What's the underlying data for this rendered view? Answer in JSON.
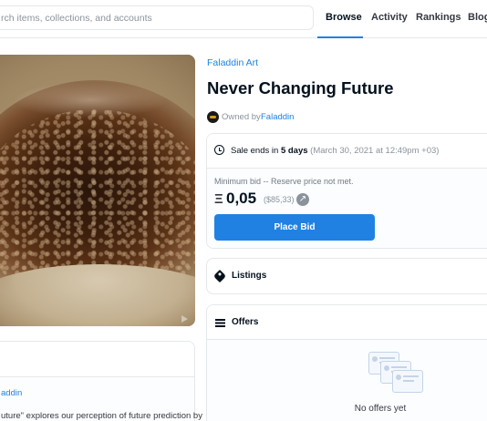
{
  "header": {
    "search_placeholder": "rch items, collections, and accounts",
    "nav": {
      "browse": "Browse",
      "activity": "Activity",
      "rankings": "Rankings",
      "blog": "Blog"
    },
    "active_nav": "Browse"
  },
  "item": {
    "collection": "Faladdin Art",
    "title": "Never Changing Future",
    "owned_by_label": "Owned by",
    "owner": "Faladdin"
  },
  "sale": {
    "ends_prefix": "Sale ends in",
    "ends_in": "5 days",
    "ends_date": "(March 30, 2021 at 12:49pm +03)",
    "min_bid_label": "Minimum bid -- Reserve price not met.",
    "currency_symbol": "Ξ",
    "price": "0,05",
    "usd_price": "($85,33)",
    "bid_button": "Place Bid"
  },
  "sections": {
    "listings": "Listings",
    "offers": "Offers",
    "no_offers": "No offers yet"
  },
  "description": {
    "creator": "addin",
    "text": "uture\" explores our perception of future prediction by"
  },
  "colors": {
    "accent": "#2081e2",
    "text": "#04111d",
    "muted": "#8a939b",
    "border": "#e5e8eb"
  },
  "icons": [
    "clock-icon",
    "eth-icon",
    "external-link-icon",
    "tag-icon",
    "list-icon",
    "play-icon"
  ]
}
